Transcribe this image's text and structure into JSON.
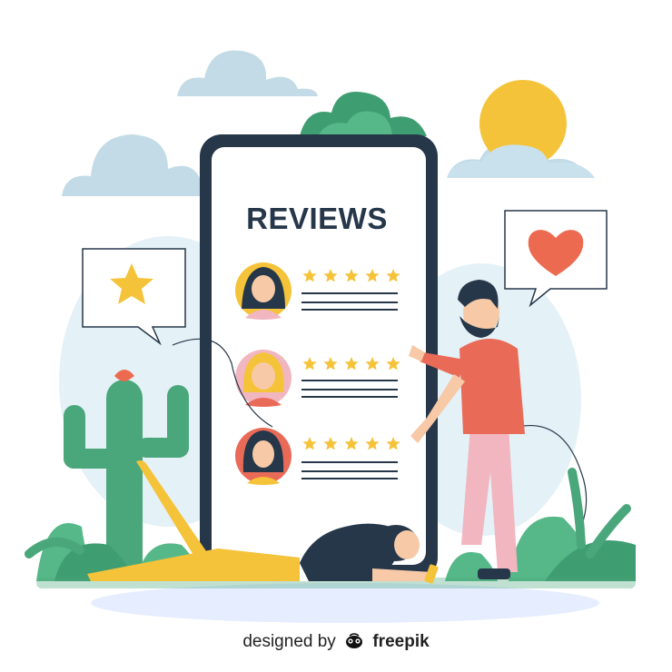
{
  "phone": {
    "title": "REVIEWS"
  },
  "reviews": [
    {
      "rating": 5,
      "avatar": "woman-dark-hair-avatar",
      "avatar_bg": "#f5c33a"
    },
    {
      "rating": 5,
      "avatar": "woman-blonde-hair-avatar",
      "avatar_bg": "#f1b6c0"
    },
    {
      "rating": 5,
      "avatar": "woman-dark-hair-avatar",
      "avatar_bg": "#ea6a58"
    }
  ],
  "bubbles": {
    "left_icon": "star-icon",
    "right_icon": "heart-icon"
  },
  "credit": {
    "prefix": "designed by",
    "brand": "freepik"
  },
  "colors": {
    "navy": "#26374a",
    "star": "#f5c33a",
    "heart": "#ec6a4f",
    "green": "#4aa77b",
    "sky": "#c8e1ec"
  }
}
